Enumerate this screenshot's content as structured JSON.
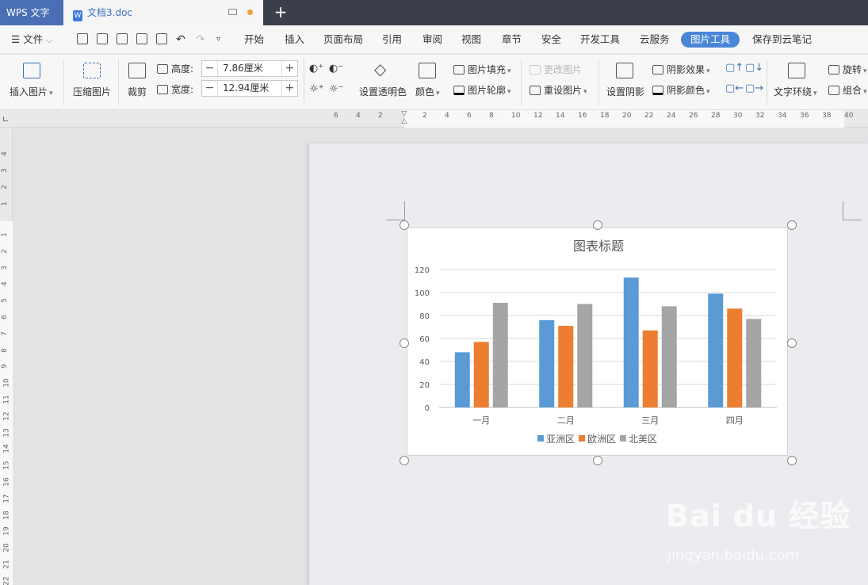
{
  "titlebar": {
    "app_label": "WPS 文字",
    "doc_name": "文档3.doc"
  },
  "menu": {
    "file": "文件",
    "tabs": [
      "开始",
      "插入",
      "页面布局",
      "引用",
      "审阅",
      "视图",
      "章节",
      "安全",
      "开发工具",
      "云服务",
      "图片工具",
      "保存到云笔记"
    ],
    "active_tab": "图片工具"
  },
  "ribbon": {
    "insert_picture": "插入图片",
    "compress_picture": "压缩图片",
    "crop": "裁剪",
    "height_label": "高度:",
    "height_value": "7.86厘米",
    "width_label": "宽度:",
    "width_value": "12.94厘米",
    "set_transparent": "设置透明色",
    "color": "颜色",
    "picture_fill": "图片填充",
    "picture_outline": "图片轮廓",
    "change_picture": "更改图片",
    "reset_picture": "重设图片",
    "set_shadow": "设置阴影",
    "shadow_effect": "阴影效果",
    "shadow_color": "阴影颜色",
    "text_wrap": "文字环绕",
    "rotate": "旋转",
    "group": "组合"
  },
  "ruler": {
    "h_ticks": [
      "6",
      "4",
      "2",
      "2",
      "4",
      "6",
      "8",
      "10",
      "12",
      "14",
      "16",
      "18",
      "20",
      "22",
      "24",
      "26",
      "28",
      "30",
      "32",
      "34",
      "36",
      "38",
      "40"
    ],
    "v_ticks": [
      "4",
      "3",
      "2",
      "1",
      "1",
      "2",
      "3",
      "4",
      "5",
      "6",
      "7",
      "8",
      "9",
      "10",
      "11",
      "12",
      "13",
      "14",
      "15",
      "16",
      "17",
      "18",
      "19",
      "20",
      "21",
      "22"
    ]
  },
  "chart_data": {
    "type": "bar",
    "title": "图表标题",
    "categories": [
      "一月",
      "二月",
      "三月",
      "四月"
    ],
    "series": [
      {
        "name": "亚洲区",
        "color": "#5b9bd5",
        "values": [
          48,
          76,
          113,
          99
        ]
      },
      {
        "name": "欧洲区",
        "color": "#ed7d31",
        "values": [
          57,
          71,
          67,
          86
        ]
      },
      {
        "name": "北美区",
        "color": "#a5a5a5",
        "values": [
          91,
          90,
          88,
          77
        ]
      }
    ],
    "yticks": [
      "0",
      "20",
      "40",
      "60",
      "80",
      "100",
      "120"
    ],
    "ylim": [
      0,
      120
    ],
    "grid": true,
    "legend": "bottom"
  },
  "watermark": {
    "main": "Bai du 经验",
    "sub": "jingyan.baidu.com"
  }
}
